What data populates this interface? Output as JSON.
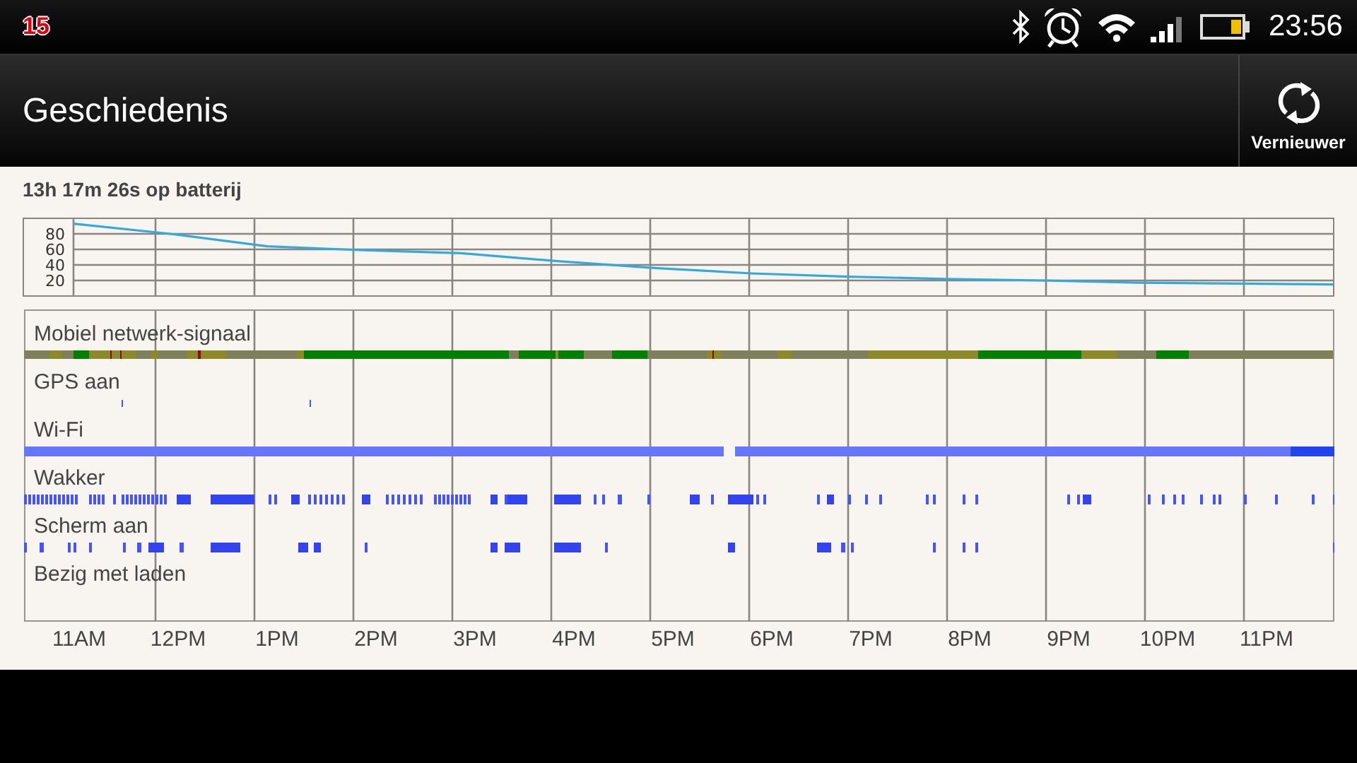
{
  "status_bar": {
    "notification_count": "15",
    "time": "23:56"
  },
  "action_bar": {
    "title": "Geschiedenis",
    "refresh_label": "Vernieuwer"
  },
  "summary": "13h 17m 26s op batterij",
  "battery_chart": {
    "chart_data": {
      "type": "line",
      "grid": true,
      "ylim": [
        0,
        100
      ],
      "yticks": [
        {
          "value": 20,
          "label": "20"
        },
        {
          "value": 40,
          "label": "40"
        },
        {
          "value": 60,
          "label": "60"
        },
        {
          "value": 80,
          "label": "80"
        }
      ],
      "categories": [
        null,
        null,
        null,
        null,
        null,
        null,
        null,
        null,
        null,
        null,
        null,
        null,
        null,
        null
      ],
      "series": [
        {
          "color": "#33aadd",
          "values": [
            93,
            80,
            64,
            59,
            55,
            45,
            36,
            29,
            25,
            22,
            20,
            17,
            16,
            15
          ]
        }
      ]
    }
  },
  "tracks": [
    {
      "label": "Mobiel netwerk-signaal",
      "kind": "signal"
    },
    {
      "label": "GPS aan",
      "kind": "ticks"
    },
    {
      "label": "Wi-Fi",
      "kind": "bar"
    },
    {
      "label": "Wakker",
      "kind": "ticks"
    },
    {
      "label": "Scherm aan",
      "kind": "ticks"
    },
    {
      "label": "Bezig met laden",
      "kind": "none"
    }
  ],
  "time_axis": [
    "11AM",
    "12PM",
    "1PM",
    "2PM",
    "3PM",
    "4PM",
    "5PM",
    "6PM",
    "7PM",
    "8PM",
    "9PM",
    "10PM",
    "11PM"
  ]
}
